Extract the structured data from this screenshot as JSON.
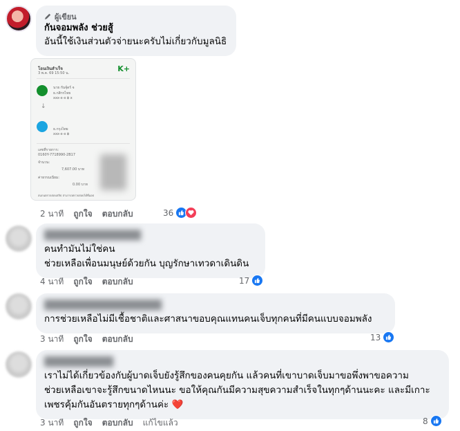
{
  "comments": [
    {
      "badge": "ผู้เขียน",
      "name": "กันจอมพลัง ช่วยสู้",
      "lines": [
        "อันนี้ใช้เงินส่วนตัวจ่ายนะครับไม่เกี่ยวกับมูลนิธิ"
      ],
      "time": "2 นาที",
      "like": "ถูกใจ",
      "reply": "ตอบกลับ",
      "reactions": "36"
    },
    {
      "lines": [
        "คนทำมันไม่ใช่คน",
        "ช่วยเหลือเพื่อนมนุษย์ด้วยกัน บุญรักษาเทวดาเดินดิน"
      ],
      "time": "4 นาที",
      "like": "ถูกใจ",
      "reply": "ตอบกลับ",
      "reactions": "17"
    },
    {
      "lines": [
        "การช่วยเหลือไม่มีเชื้อชาติและศาสนาขอบคุณแทนคนเจ็บทุกคนที่มีคนแบบจอมพลัง"
      ],
      "time": "3 นาที",
      "like": "ถูกใจ",
      "reply": "ตอบกลับ",
      "reactions": "13"
    },
    {
      "lines": [
        "เราไม่ได้เกี่ยวข้องกับผู้บาดเจ็บยังรู้สึกของคนคุยกัน แล้วคนที่เขาบาดเจ็บมาขอพึ่งพาขอความ",
        "ช่วยเหลือเขาจะรู้สึกขนาดไหนนะ ขอให้คุณกันมีความสุขความสำเร็จในทุกๆด้านนะคะ และมีเกาะ",
        "เพชรคุ้มกันอันตรายทุกๆด้านค่ะ ❤️"
      ],
      "time": "3 นาที",
      "like": "ถูกใจ",
      "reply": "ตอบกลับ",
      "edited": "แก้ไขแล้ว",
      "reactions": "8"
    }
  ],
  "receipt": {
    "title": "โอนเงินสำเร็จ",
    "date": "3 พ.ค. 69 15:50 น.",
    "brand": "K+",
    "sender_name": "นาย กันจุ์ดร์ จ",
    "sender_bank": "ธ.กสิกรไทย",
    "sender_acct": "xxx-x-x ฿ x",
    "receiver_bank": "ธ.กรุงไทย",
    "receiver_acct": "xxx-x-x ฿",
    "ref_label": "เลขที่รายการ:",
    "ref_value": "0160Y-7718990-2B17",
    "amount_label": "จำนวน:",
    "amount_value": "7,607.00 บาท",
    "fee_label": "ค่าธรรมเนียม:",
    "fee_value": "0.00 บาท",
    "footer": "สแกนตรวจสอบสลิป สามารถตรวจสอบได้ที่แอป"
  },
  "colors": {
    "bubble": "#f0f2f5",
    "like_blue": "#1877f2",
    "love_red": "#f33e58",
    "kbank_green": "#138f2d"
  }
}
